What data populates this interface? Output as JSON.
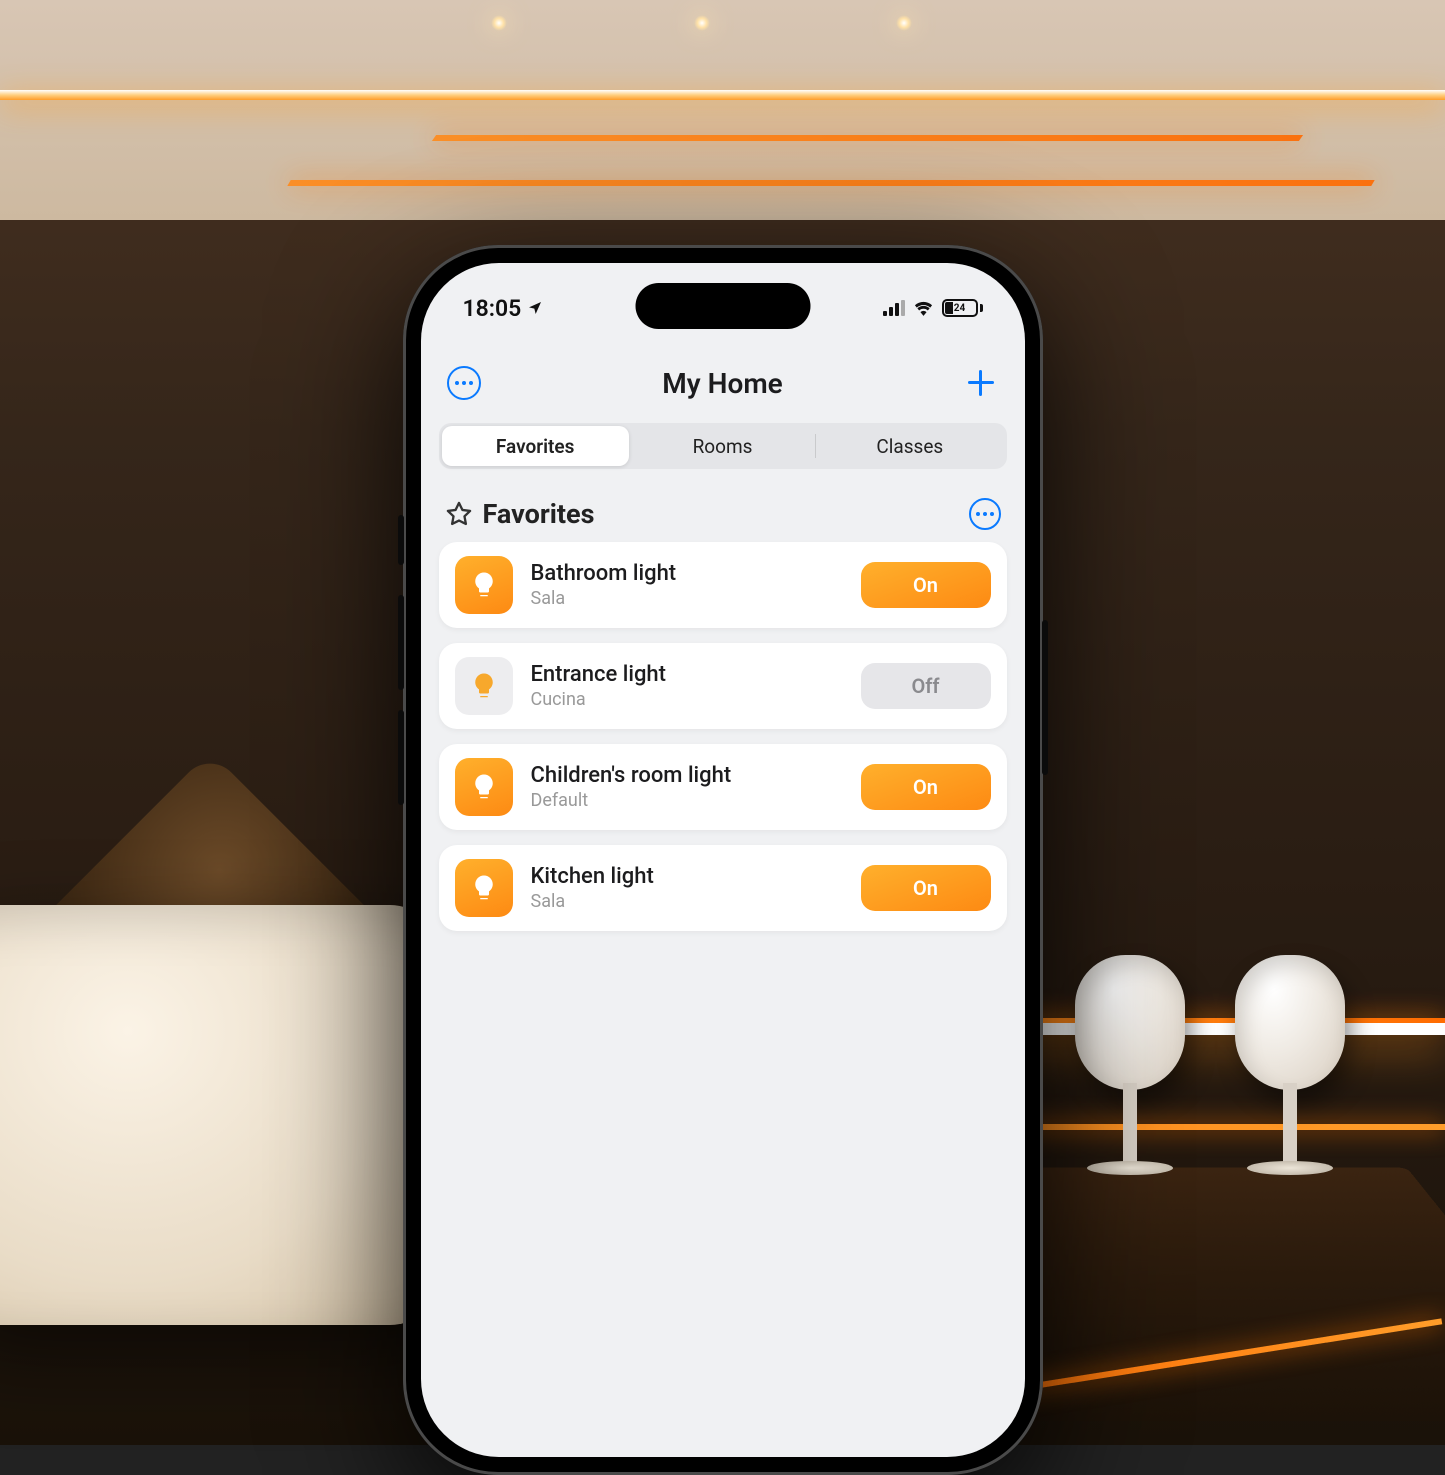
{
  "status": {
    "time": "18:05",
    "battery_text": "24"
  },
  "navbar": {
    "title": "My Home"
  },
  "tabs": [
    "Favorites",
    "Rooms",
    "Classes"
  ],
  "active_tab_index": 0,
  "section": {
    "title": "Favorites"
  },
  "lights": [
    {
      "name": "Bathroom light",
      "room": "Sala",
      "state": "On",
      "on": true
    },
    {
      "name": "Entrance light",
      "room": "Cucina",
      "state": "Off",
      "on": false
    },
    {
      "name": "Children's room light",
      "room": "Default",
      "state": "On",
      "on": true
    },
    {
      "name": "Kitchen light",
      "room": "Sala",
      "state": "On",
      "on": true
    }
  ]
}
